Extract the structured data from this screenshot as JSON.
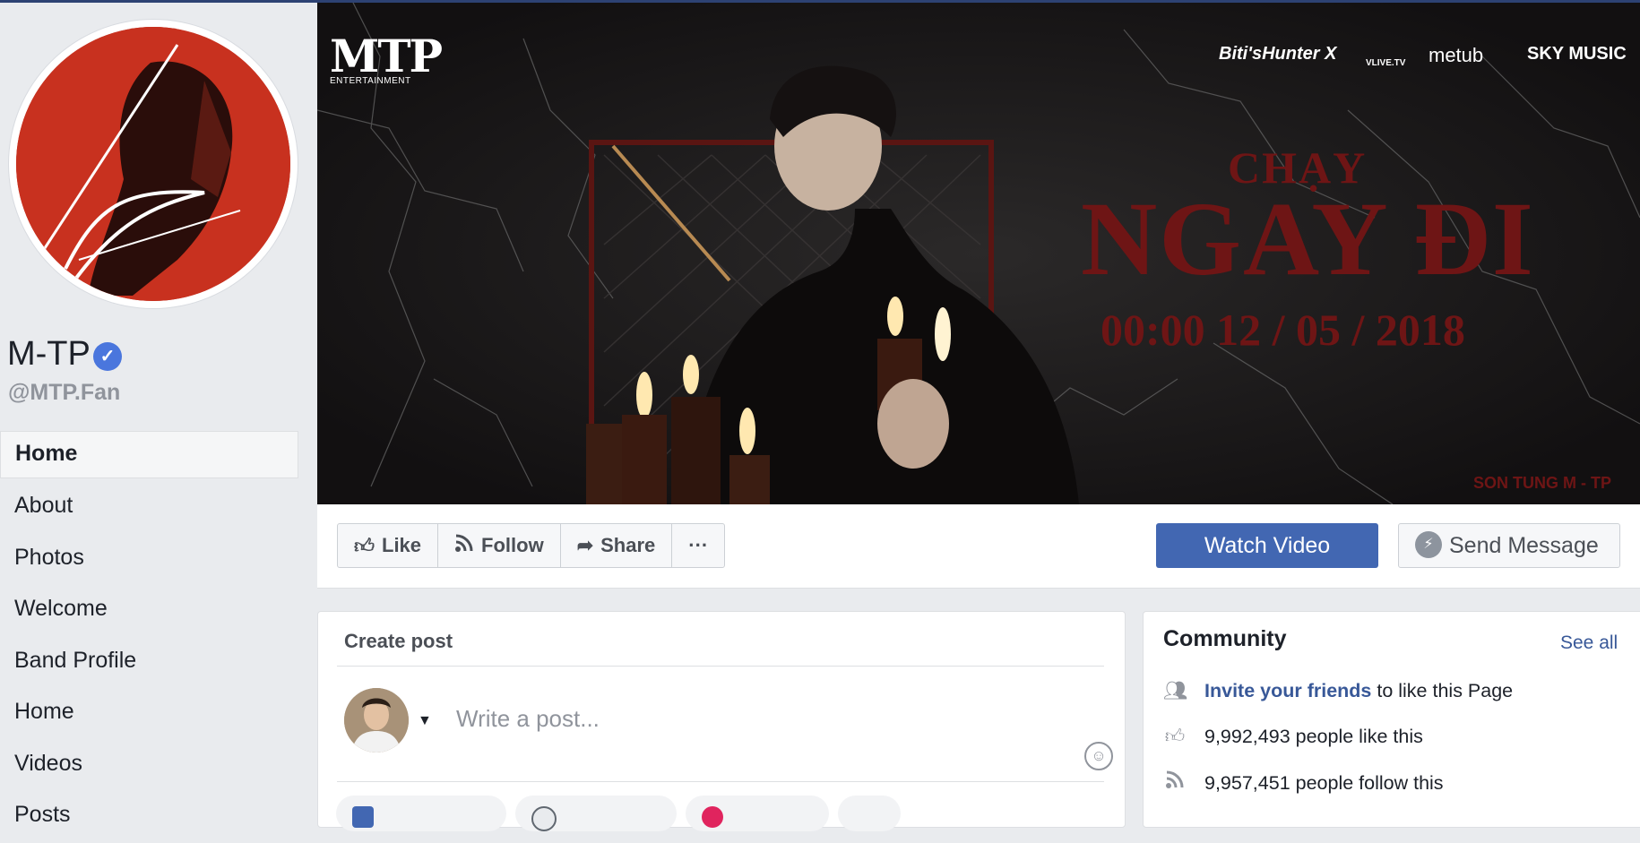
{
  "page": {
    "name": "M-TP",
    "handle": "@MTP.Fan",
    "verified_icon": "check-badge-icon"
  },
  "nav": {
    "items": [
      {
        "label": "Home",
        "active": true
      },
      {
        "label": "About"
      },
      {
        "label": "Photos"
      },
      {
        "label": "Welcome"
      },
      {
        "label": "Band Profile"
      },
      {
        "label": "Home"
      },
      {
        "label": "Videos"
      },
      {
        "label": "Posts"
      }
    ]
  },
  "cover": {
    "logo": "MTP",
    "logo_sub": "ENTERTAINMENT",
    "sponsors": [
      "Biti'sHunter X",
      "VLIVE.TV",
      "metub",
      "SKY MUSIC"
    ],
    "title_line1": "CHẠY",
    "title_line2": "NGAY ĐI",
    "date": "00:00 12 / 05 / 2018",
    "signature": "SON TUNG M - TP"
  },
  "actions": {
    "like": "Like",
    "follow": "Follow",
    "share": "Share",
    "more": "···",
    "watch_video": "Watch Video",
    "send_message": "Send Message"
  },
  "create_post": {
    "title": "Create post",
    "placeholder": "Write a post..."
  },
  "community": {
    "title": "Community",
    "see_all": "See all",
    "invite_link": "Invite your friends",
    "invite_rest": " to like this Page",
    "likes": "9,992,493 people like this",
    "follows": "9,957,451 people follow this"
  },
  "colors": {
    "accent": "#4267b2",
    "link": "#385898",
    "cover_text": "#6e1515",
    "verified": "#4a76dd"
  }
}
